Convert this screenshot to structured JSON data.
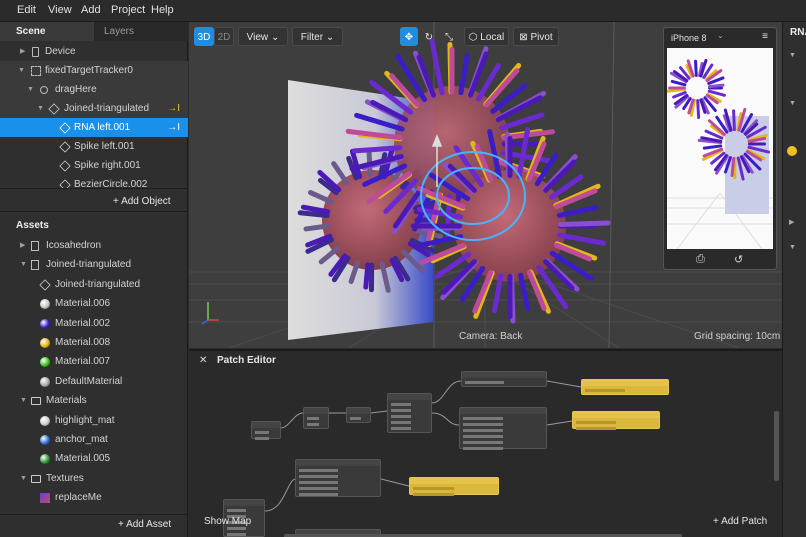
{
  "menu": [
    "Edit",
    "View",
    "Add",
    "Project",
    "Help"
  ],
  "left": {
    "tabs": {
      "scene": "Scene",
      "layers": "Layers"
    },
    "scene_items": [
      {
        "label": "Device",
        "icon": "device-icon"
      },
      {
        "label": "fixedTargetTracker0",
        "icon": "tracker-icon"
      },
      {
        "label": "dragHere",
        "icon": "null-object-icon"
      },
      {
        "label": "Joined-triangulated",
        "icon": "mesh-icon"
      },
      {
        "label": "RNA left.001",
        "icon": "mesh-icon"
      },
      {
        "label": "Spike left.001",
        "icon": "mesh-icon"
      },
      {
        "label": "Spike right.001",
        "icon": "mesh-icon"
      },
      {
        "label": "BezierCircle.002",
        "icon": "mesh-icon"
      }
    ],
    "add_object": "Add Object",
    "assets_title": "Assets",
    "assets": [
      {
        "label": "Icosahedron",
        "kind": "file",
        "indent": 1,
        "arrow": true
      },
      {
        "label": "Joined-triangulated",
        "kind": "file",
        "indent": 1,
        "arrow": true
      },
      {
        "label": "Joined-triangulated",
        "kind": "cube",
        "indent": 2,
        "arrow": false
      },
      {
        "label": "Material.006",
        "kind": "ball",
        "color": "#c8c8c8",
        "indent": 2,
        "arrow": false
      },
      {
        "label": "Material.002",
        "kind": "ball",
        "color": "#3b1cc9",
        "indent": 2,
        "arrow": false
      },
      {
        "label": "Material.008",
        "kind": "ball",
        "color": "#e4b613",
        "indent": 2,
        "arrow": false
      },
      {
        "label": "Material.007",
        "kind": "ball",
        "color": "#3fc617",
        "indent": 2,
        "arrow": false
      },
      {
        "label": "DefaultMaterial",
        "kind": "ball",
        "color": "#aaaaaa",
        "indent": 2,
        "arrow": false
      },
      {
        "label": "Materials",
        "kind": "folder",
        "indent": 1,
        "arrow": true
      },
      {
        "label": "highlight_mat",
        "kind": "ball",
        "color": "#cfcfcf",
        "indent": 2,
        "arrow": false
      },
      {
        "label": "anchor_mat",
        "kind": "ball",
        "color": "#2d6fd6",
        "indent": 2,
        "arrow": false
      },
      {
        "label": "Material.005",
        "kind": "ball",
        "color": "#2f9a2f",
        "indent": 2,
        "arrow": false
      },
      {
        "label": "Textures",
        "kind": "folder",
        "indent": 1,
        "arrow": true
      },
      {
        "label": "replaceMe",
        "kind": "texture",
        "indent": 2,
        "arrow": false
      }
    ],
    "add_asset": "Add Asset"
  },
  "viewport": {
    "mode_3d": "3D",
    "mode_2d": "2D",
    "view": "View",
    "filter": "Filter",
    "local": "Local",
    "pivot": "Pivot",
    "camera": "Camera: Back",
    "grid": "Grid spacing: 10cm",
    "device": "iPhone 8"
  },
  "right": {
    "title": "RNA"
  },
  "patch": {
    "title": "Patch Editor",
    "show_map": "Show Map",
    "add_patch": "Add Patch"
  },
  "colors": {
    "accent": "#1990ea",
    "virus_purple": "#4b1ab5",
    "virus_body": "#a04f59",
    "spike_yellow": "#e2b818",
    "selection": "#3aa8ff"
  }
}
